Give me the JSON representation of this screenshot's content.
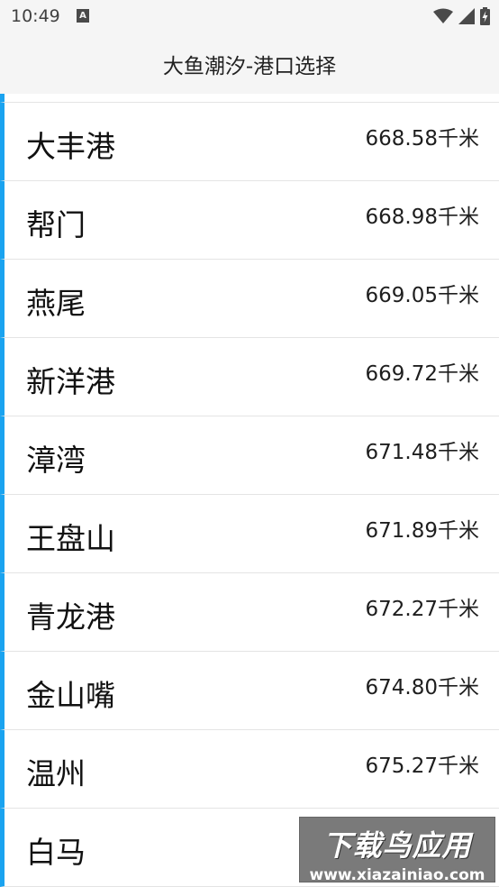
{
  "status_bar": {
    "time": "10:49",
    "notification_badge": "A",
    "icons": [
      "wifi-icon",
      "signal-icon",
      "battery-charging-icon"
    ]
  },
  "app_bar": {
    "title": "大鱼潮汐-港口选择"
  },
  "colors": {
    "accent": "#1aa3f0",
    "divider": "#e4e4e4",
    "bar_background": "#f5f5f5"
  },
  "ports": [
    {
      "name": "大丰港",
      "distance": "668.58千米"
    },
    {
      "name": "帮门",
      "distance": "668.98千米"
    },
    {
      "name": "燕尾",
      "distance": "669.05千米"
    },
    {
      "name": "新洋港",
      "distance": "669.72千米"
    },
    {
      "name": "漳湾",
      "distance": "671.48千米"
    },
    {
      "name": "王盘山",
      "distance": "671.89千米"
    },
    {
      "name": "青龙港",
      "distance": "672.27千米"
    },
    {
      "name": "金山嘴",
      "distance": "674.80千米"
    },
    {
      "name": "温州",
      "distance": "675.27千米"
    },
    {
      "name": "白马",
      "distance": ""
    }
  ],
  "watermark": {
    "title": "下载鸟应用",
    "url": "www.xiazainiao.com"
  }
}
